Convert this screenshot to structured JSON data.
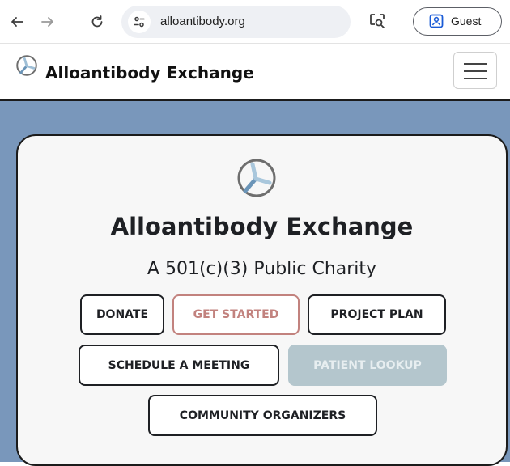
{
  "browser": {
    "url": "alloantibody.org",
    "profile_label": "Guest",
    "icons": [
      "back-arrow-icon",
      "forward-arrow-icon",
      "reload-icon",
      "site-settings-icon",
      "lens-search-icon",
      "profile-icon"
    ]
  },
  "navbar": {
    "brand": "Alloantibody Exchange",
    "logo_icon": "antibody-logo-icon",
    "menu_icon": "hamburger-menu-icon"
  },
  "hero": {
    "title": "Alloantibody Exchange",
    "subtitle": "A 501(c)(3) Public Charity",
    "buttons": {
      "donate": "DONATE",
      "get_started": "GET STARTED",
      "project_plan": "PROJECT PLAN",
      "schedule_meeting": "SCHEDULE A MEETING",
      "patient_lookup": "PATIENT LOOKUP",
      "community_organizers": "COMMUNITY ORGANIZERS"
    }
  },
  "colors": {
    "hero_background": "#7997bb",
    "card_background": "#f7f7f7",
    "get_started_accent": "#c2827e",
    "disabled_button": "#b4c6cd",
    "logo_accent": "#7da7c5"
  }
}
